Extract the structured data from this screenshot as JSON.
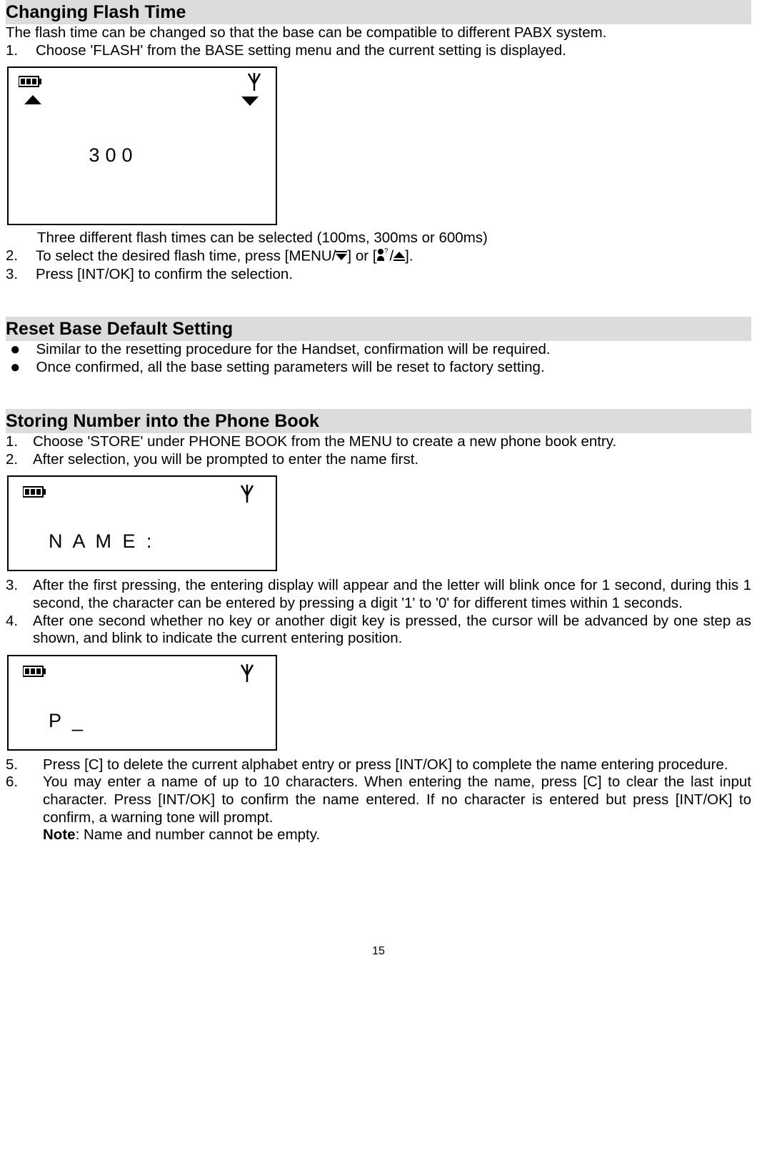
{
  "sections": {
    "flash": {
      "title": "Changing Flash Time",
      "intro": "The flash time can be changed so that the base can be compatible to different PABX system.",
      "step1_num": "1.",
      "step1": "Choose 'FLASH' from the BASE setting menu and the current setting is displayed.",
      "lcd_value": "300",
      "note_under_lcd": "Three different flash times can be selected (100ms, 300ms or 600ms)",
      "step2_num": "2.",
      "step2_a": "To select the desired flash time, press [MENU/",
      "step2_b": "] or [",
      "step2_c": "/",
      "step2_d": "].",
      "step3_num": "3.",
      "step3": " Press [INT/OK] to confirm the selection."
    },
    "reset": {
      "title": "Reset Base Default Setting",
      "b1": "Similar to the resetting procedure for the Handset, confirmation will be required.",
      "b2": "Once confirmed, all the base setting parameters will be reset to factory setting."
    },
    "store": {
      "title": "Storing Number into the Phone Book",
      "s1_num": "1.",
      "s1": "Choose 'STORE' under PHONE BOOK from the MENU to create a new phone book entry.",
      "s2_num": "2.",
      "s2": "After selection, you will be prompted to enter the name first.",
      "lcd_name": "N A M E :",
      "s3_num": "3.",
      "s3": "After the first pressing, the entering display will appear and the letter will blink once for 1 second, during this 1 second, the character can be entered by pressing a digit '1' to '0' for different times within 1 seconds.",
      "s4_num": "4.",
      "s4": "After one second whether no key or another digit key is pressed, the cursor will be advanced by one step as shown, and blink to indicate the current entering position.",
      "lcd_p": "P _",
      "s5_num": "5.",
      "s5": "Press [C] to delete the current alphabet entry or press [INT/OK] to complete the name entering procedure.",
      "s6_num": "6.",
      "s6": "You may enter a name of up to 10 characters. When entering the name, press [C] to clear the last input character. Press [INT/OK] to confirm the name entered. If no character is entered but press [INT/OK] to confirm, a warning tone will prompt.",
      "note_label": "Note",
      "note_text": ": Name and number cannot be empty."
    }
  },
  "page_number": "15"
}
